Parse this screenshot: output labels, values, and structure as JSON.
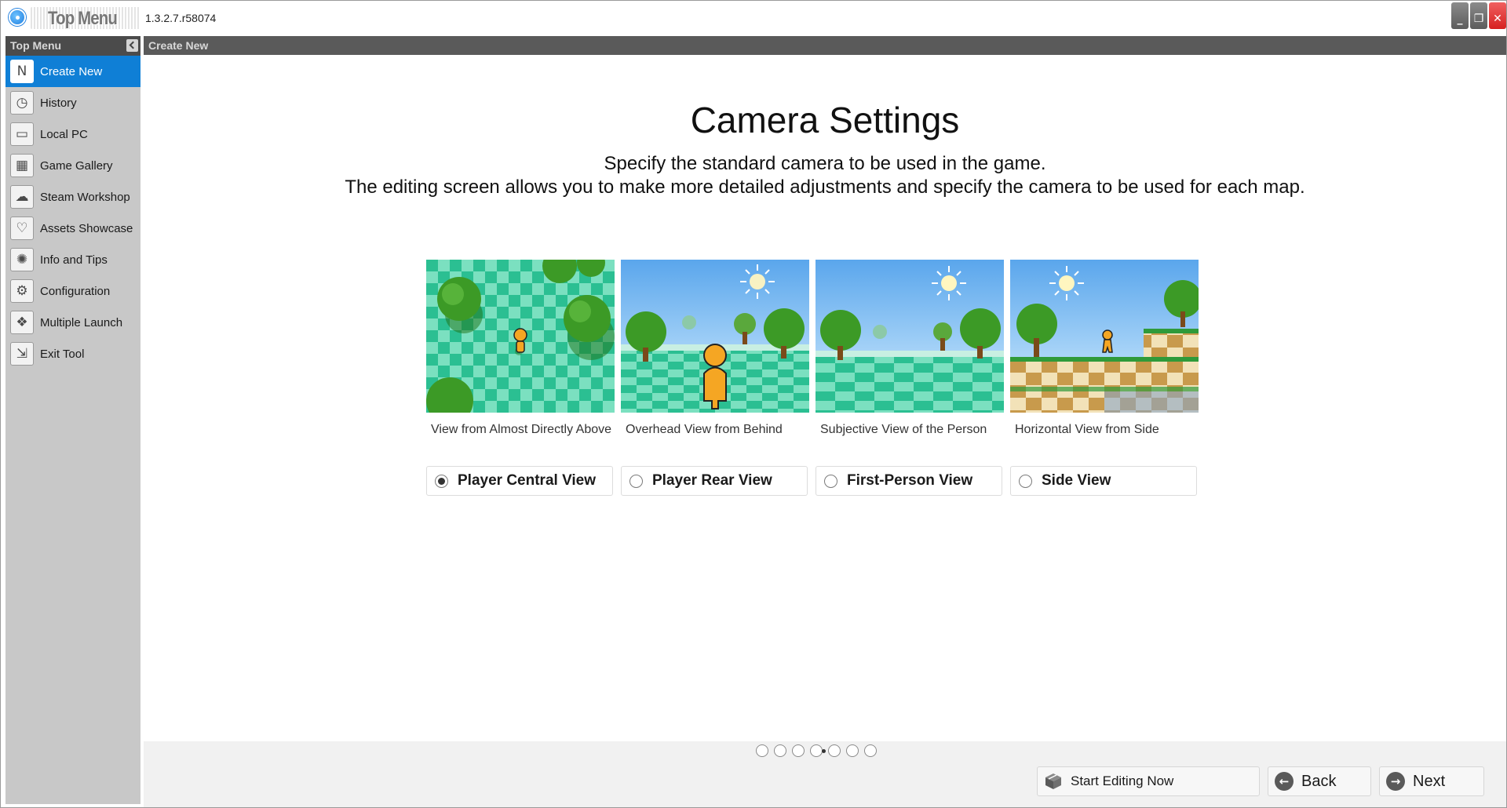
{
  "window": {
    "title_logo": "Top Menu",
    "version": "1.3.2.7.r58074",
    "minimize_glyph": "_",
    "restore_glyph": "❐",
    "close_glyph": "✕"
  },
  "sidebar": {
    "header": "Top Menu",
    "items": [
      {
        "label": "Create New",
        "icon": "new-document-icon",
        "glyph": "N",
        "active": true
      },
      {
        "label": "History",
        "icon": "history-icon",
        "glyph": "◷"
      },
      {
        "label": "Local PC",
        "icon": "monitor-icon",
        "glyph": "▭"
      },
      {
        "label": "Game Gallery",
        "icon": "game-gallery-icon",
        "glyph": "▦"
      },
      {
        "label": "Steam Workshop",
        "icon": "cloud-icon",
        "glyph": "☁"
      },
      {
        "label": "Assets Showcase",
        "icon": "heart-download-icon",
        "glyph": "♡"
      },
      {
        "label": "Info and Tips",
        "icon": "lightbulb-icon",
        "glyph": "✺"
      },
      {
        "label": "Configuration",
        "icon": "gear-icon",
        "glyph": "⚙"
      },
      {
        "label": "Multiple Launch",
        "icon": "multiple-launch-icon",
        "glyph": "❖"
      },
      {
        "label": "Exit Tool",
        "icon": "exit-icon",
        "glyph": "⇲"
      }
    ]
  },
  "content_header": "Create New",
  "main": {
    "title": "Camera Settings",
    "desc_line1": "Specify the standard camera to be used in the game.",
    "desc_line2": "The editing screen allows you to make more detailed adjustments and specify the camera to be used for each map."
  },
  "cards": [
    {
      "caption": "View from Almost Directly Above",
      "option": "Player Central View",
      "selected": true
    },
    {
      "caption": "Overhead View from Behind",
      "option": "Player Rear View",
      "selected": false
    },
    {
      "caption": "Subjective View of the Person",
      "option": "First-Person View",
      "selected": false
    },
    {
      "caption": "Horizontal View from Side",
      "option": "Side View",
      "selected": false
    }
  ],
  "pagination": {
    "total": 7,
    "current": 4
  },
  "footer": {
    "start_label": "Start Editing Now",
    "back_label": "Back",
    "next_label": "Next",
    "back_glyph": "←",
    "next_glyph": "→"
  },
  "colors": {
    "accent": "#0f7fd6",
    "sidebar_bg": "#c8c8c8",
    "header_bg": "#5a5a5a",
    "sky": "#6eb6ee",
    "checker_light": "#7be0c0",
    "checker_dark": "#2bbf92",
    "tree": "#2f8a1f",
    "person": "#f5a623"
  }
}
